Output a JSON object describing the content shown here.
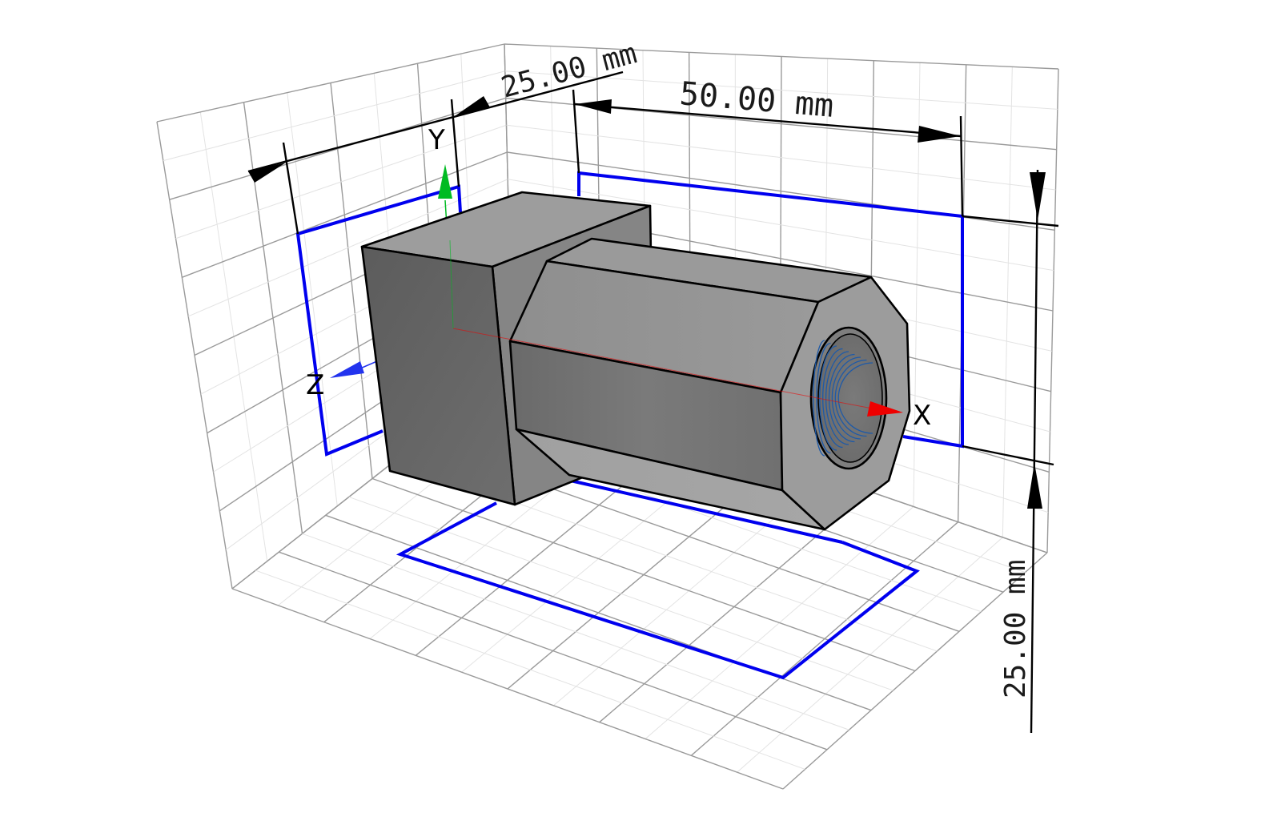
{
  "dimensions": {
    "depth": "25.00 mm",
    "length": "50.00 mm",
    "height": "25.00 mm"
  },
  "axes": {
    "x": "X",
    "y": "Y",
    "z": "Z"
  },
  "colors": {
    "background": "#ffffff",
    "projection": "#0000ee",
    "body_front": "#6c6c6c",
    "body_top": "#9e9e9e",
    "body_side": "#858585",
    "x_axis": "#ee0000",
    "y_axis": "#00bb22",
    "z_axis": "#2233ee",
    "thread": "#1e5aa8"
  }
}
